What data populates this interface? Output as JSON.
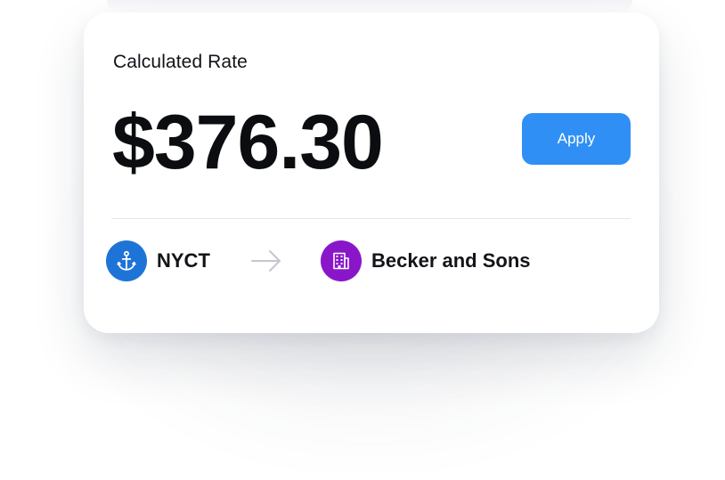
{
  "card": {
    "label": "Calculated Rate",
    "value": "$376.30",
    "apply_label": "Apply"
  },
  "route": {
    "origin": {
      "name": "NYCT",
      "icon": "anchor-icon",
      "color": "#1e74d6"
    },
    "destination": {
      "name": "Becker and Sons",
      "icon": "building-icon",
      "color": "#8a16c9"
    },
    "arrow_icon": "arrow-right-icon"
  },
  "colors": {
    "accent": "#2f8ff5"
  }
}
